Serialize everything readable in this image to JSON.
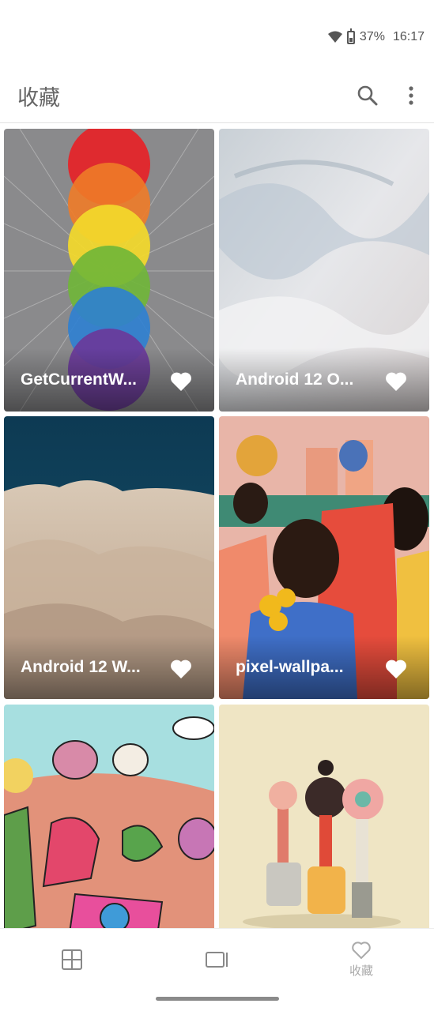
{
  "status_bar": {
    "battery": "37%",
    "time": "16:17"
  },
  "app_bar": {
    "title": "收藏"
  },
  "wallpapers": [
    {
      "title": "GetCurrentW..."
    },
    {
      "title": "Android 12 O..."
    },
    {
      "title": "Android 12 W..."
    },
    {
      "title": "pixel-wallpa..."
    },
    {
      "title": ""
    },
    {
      "title": ""
    }
  ],
  "bottom_nav": {
    "favorites_label": "收藏"
  }
}
